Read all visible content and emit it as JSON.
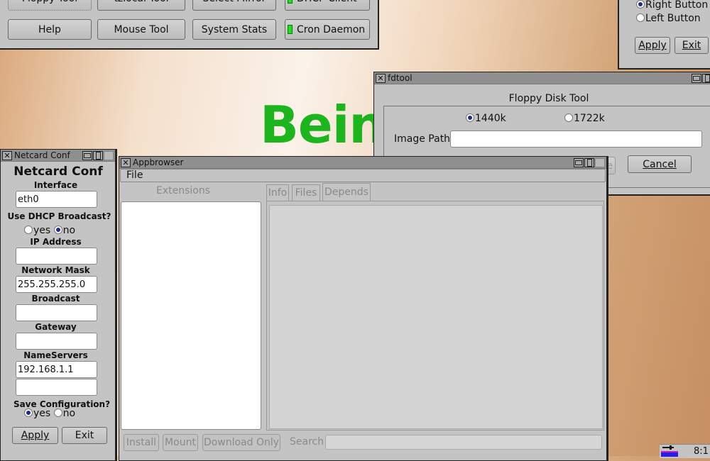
{
  "desktop": {
    "banner_text": "Bein",
    "banner_color": "#1db51d"
  },
  "control_panel": {
    "row1": [
      {
        "label": "Floppy Tool"
      },
      {
        "label": "tzlocal Tool"
      },
      {
        "label": "Select Mirror"
      },
      {
        "label": "DHCP Client",
        "led": true
      }
    ],
    "row2": [
      {
        "label": "Help"
      },
      {
        "label": "Mouse Tool"
      },
      {
        "label": "System Stats"
      },
      {
        "label": "Cron Daemon",
        "led": true
      }
    ]
  },
  "mouse_tool": {
    "options": [
      {
        "label": "Right Button",
        "selected": true
      },
      {
        "label": "Left Button",
        "selected": false
      }
    ],
    "apply_label": "Apply",
    "exit_label": "Exit"
  },
  "fdtool": {
    "title": "fdtool",
    "heading": "Floppy Disk Tool",
    "size_options": [
      {
        "label": "1440k",
        "selected": true
      },
      {
        "label": "1722k",
        "selected": false
      }
    ],
    "image_path_label": "Image Path:",
    "image_path_value": "",
    "cancel_label": "Cancel",
    "hidden_button_fragment": "e"
  },
  "netcard": {
    "title": "Netcard Conf",
    "heading": "Netcard Conf",
    "interface_label": "Interface",
    "interface_value": "eth0",
    "dhcp_label": "Use DHCP Broadcast?",
    "dhcp_options": [
      {
        "label": "yes",
        "selected": false
      },
      {
        "label": "no",
        "selected": true
      }
    ],
    "ip_label": "IP Address",
    "ip_value": "",
    "mask_label": "Network Mask",
    "mask_value": "255.255.255.0",
    "broadcast_label": "Broadcast",
    "broadcast_value": "",
    "gateway_label": "Gateway",
    "gateway_value": "",
    "nameservers_label": "NameServers",
    "nameserver1": "192.168.1.1",
    "nameserver2": "",
    "save_label": "Save Configuration?",
    "save_options": [
      {
        "label": "yes",
        "selected": true
      },
      {
        "label": "no",
        "selected": false
      }
    ],
    "apply_label": "Apply",
    "exit_label": "Exit"
  },
  "appbrowser": {
    "title": "Appbrowser",
    "menu": [
      "File"
    ],
    "extensions_label": "Extensions",
    "tabs": [
      "Info",
      "Files",
      "Depends"
    ],
    "install_label": "Install",
    "mount_label": "Mount",
    "download_label": "Download Only",
    "search_label": "Search",
    "search_value": ""
  },
  "taskbar": {
    "clock": "8:1"
  }
}
